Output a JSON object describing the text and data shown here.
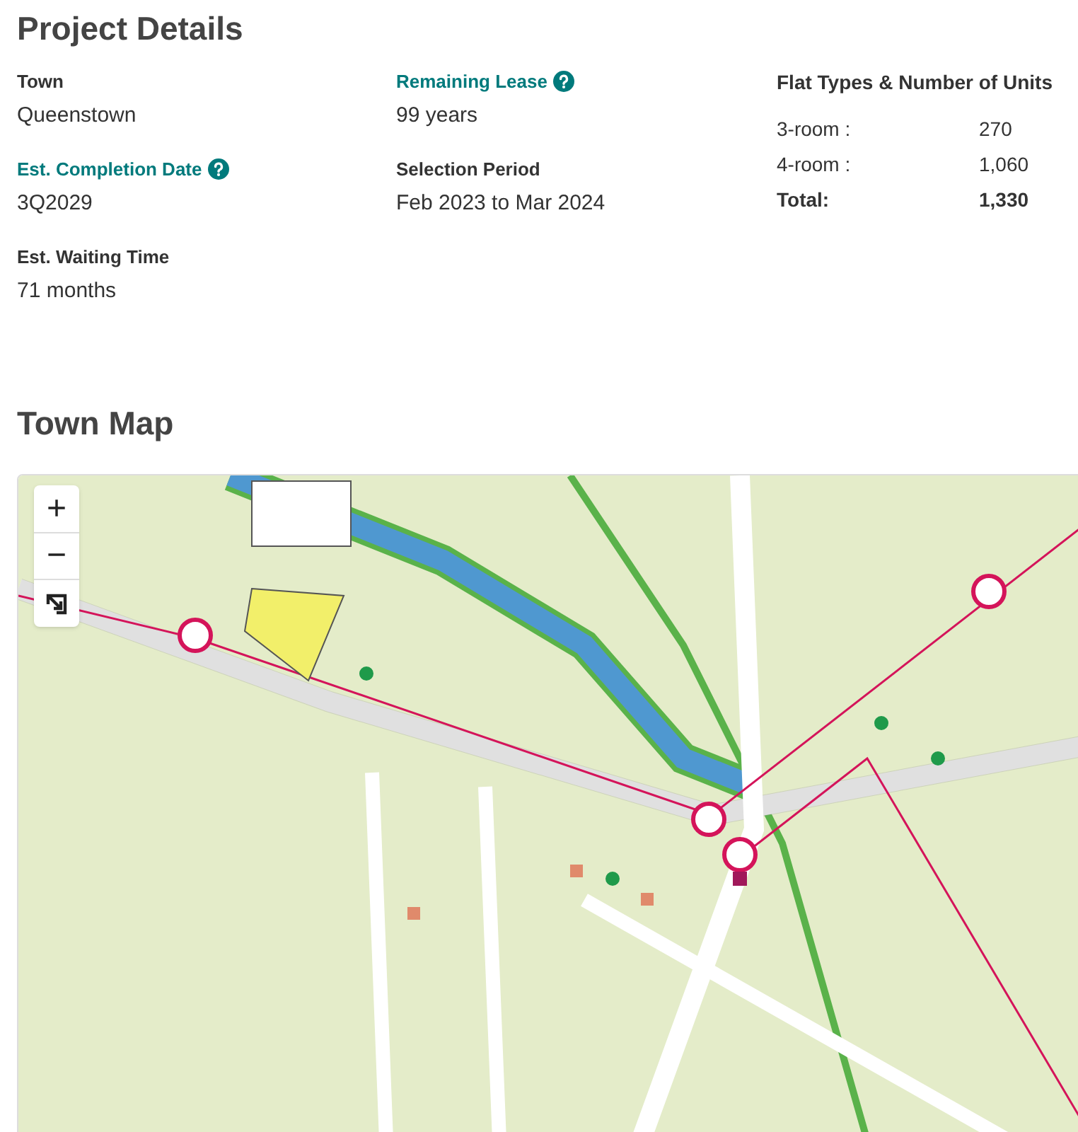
{
  "project_details": {
    "title": "Project Details",
    "columns": [
      [
        {
          "label": "Town",
          "value": "Queenstown",
          "help": false
        },
        {
          "label": "Est. Completion Date",
          "value": "3Q2029",
          "help": true
        },
        {
          "label": "Est. Waiting Time",
          "value": "71 months",
          "help": false
        }
      ],
      [
        {
          "label": "Remaining Lease",
          "value": "99 years",
          "help": true
        },
        {
          "label": "Selection Period",
          "value": "Feb 2023 to Mar 2024",
          "help": false
        }
      ]
    ],
    "flat_types": {
      "title": "Flat Types & Number of Units",
      "rows": [
        {
          "type": "3-room :",
          "units": "270",
          "kind": "item"
        },
        {
          "type": "4-room :",
          "units": "1,060",
          "kind": "item"
        },
        {
          "type": "Total:",
          "units": "1,330",
          "kind": "total"
        }
      ]
    }
  },
  "town_map": {
    "title": "Town Map",
    "controls": [
      "+",
      "−"
    ]
  }
}
